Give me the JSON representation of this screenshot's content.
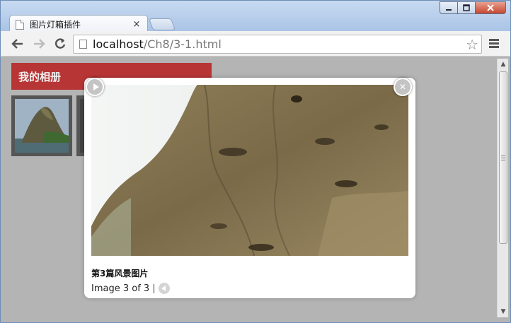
{
  "browser": {
    "tab_title": "图片灯箱插件",
    "tab_close": "×",
    "url_host": "localhost",
    "url_path": "/Ch8/3-1.html"
  },
  "page": {
    "album_title": "我的相册"
  },
  "lightbox": {
    "caption": "第3篇风景图片",
    "counter": "Image 3 of 3"
  },
  "icons": {
    "back": "arrow-left-icon",
    "forward": "arrow-right-icon",
    "reload": "reload-icon",
    "star": "star-icon",
    "menu": "hamburger-menu-icon",
    "play": "play-icon",
    "close": "close-icon",
    "prev": "previous-icon"
  },
  "colors": {
    "album_header": "#b83535",
    "page_background": "#b4b4b4"
  }
}
